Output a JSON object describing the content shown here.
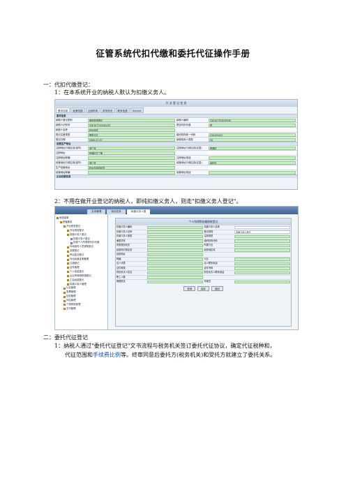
{
  "document": {
    "title": "征管系统代扣代缴和委托代征操作手册",
    "sec1_heading": "一：代扣代缴登记：",
    "sec1_item1": "1：在本系统开业的纳税人默认为扣缴义务人。",
    "sec1_item2": "2：不用在做开业登记的纳税人，即纯扣缴义务人，则走\"扣缴义务人登记\"。",
    "sec2_heading": "二：委托代征登记",
    "sec2_item1_line1": "1：纳税人通过\"委托代征登记\"文书流程与税务机关签订委托代征协议，确定代征税种和，",
    "sec2_item1_line2_plain": "代征范围和",
    "sec2_item1_line2_blue": "手续费比例",
    "sec2_item1_line2_rest": "等。终审同意后委托方(税务机关)和受托方就建立了委托关系。"
  },
  "screenshot1": {
    "title": "开 业 登 记 信 息",
    "tabs": [
      "基本信息",
      "经营范围",
      "注册机构",
      "财务机关",
      "联系信息",
      "Submit"
    ],
    "section_basic": "基本信息",
    "rows": [
      {
        "l1": "纳税人登记类别",
        "v1": "组织机构登记",
        "l2": "纳税人编码",
        "v2": "330107703030930"
      },
      {
        "l1": "纳税人识别号",
        "v1": "330107712342432",
        "l2": "是否代扣代缴",
        "v2": "是"
      },
      {
        "l1": "纳税人名称",
        "v1": "杭州测试",
        "l2": "",
        "v2": ""
      },
      {
        "l1": "登记注册类型",
        "v1": "国有企业",
        "l2": "组织机构统一代码",
        "v2": "232432432"
      },
      {
        "l1": "登记日期",
        "v1": "2080-07-07",
        "l2": "纳税信用人类型",
        "v2": "20"
      }
    ],
    "section_address": "经营生产地址",
    "address_rows": [
      {
        "l1": "注册地址行政区划(省市)",
        "v1": "浙江省",
        "l2": "注册地址行政区划(区县)",
        "v2": "西湖区"
      },
      {
        "l1": "注册地址",
        "v1": "西湖区文三路",
        "l2": "",
        "v2": ""
      },
      {
        "l1": "注册地址邮编",
        "v1": "",
        "l2": "注册地址电话",
        "v2": ""
      },
      {
        "l1": "经营地址行政区划(省市)",
        "v1": "浙江省",
        "l2": "经营地址行政区划(区县)",
        "v2": "余杭区"
      },
      {
        "l1": "生产经营地址",
        "v1": "杭州市余杭经济",
        "l2": "",
        "v2": ""
      },
      {
        "l1": "经营地址邮编",
        "v1": "",
        "l2": "经营地址电话",
        "v2": ""
      }
    ],
    "section_more": "企业经营信息"
  },
  "screenshot2": {
    "tabs": [
      "文本管理",
      "待办任务",
      "扣缴义务人登"
    ],
    "tree": [
      {
        "label": "系统菜单",
        "indent": 0,
        "kind": "folder"
      },
      {
        "label": "税管服务",
        "indent": 1,
        "kind": "folder"
      },
      {
        "label": "开业税务登记",
        "indent": 2,
        "kind": "folder"
      },
      {
        "label": "开业税务登记",
        "indent": 3,
        "kind": "folder"
      },
      {
        "label": "扣缴义务人登记",
        "indent": 3,
        "kind": "folder"
      },
      {
        "label": "扣缴义务人登记",
        "indent": 4,
        "kind": "doc"
      },
      {
        "label": "扣缴个人所得税代扣代缴",
        "indent": 4,
        "kind": "doc"
      },
      {
        "label": "外地临时人员报验登记",
        "indent": 3,
        "kind": "folder"
      },
      {
        "label": "变更登记",
        "indent": 3,
        "kind": "folder"
      },
      {
        "label": "停业复业登记",
        "indent": 3,
        "kind": "folder"
      },
      {
        "label": "外出经营证明管理",
        "indent": 3,
        "kind": "folder"
      },
      {
        "label": "注销登记",
        "indent": 3,
        "kind": "folder"
      },
      {
        "label": "证件管理",
        "indent": 3,
        "kind": "folder"
      },
      {
        "label": "个人信息登记",
        "indent": 3,
        "kind": "folder"
      },
      {
        "label": "企业所得税税源登记",
        "indent": 3,
        "kind": "folder"
      },
      {
        "label": "工会经费登记",
        "indent": 3,
        "kind": "folder"
      },
      {
        "label": "扣缴义务人管理",
        "indent": 3,
        "kind": "folder"
      },
      {
        "label": "认定管理",
        "indent": 2,
        "kind": "folder"
      },
      {
        "label": "发票管理",
        "indent": 2,
        "kind": "folder"
      },
      {
        "label": "征收管理",
        "indent": 2,
        "kind": "folder"
      },
      {
        "label": "评估管理",
        "indent": 2,
        "kind": "folder"
      },
      {
        "label": "个体税收管理",
        "indent": 2,
        "kind": "folder"
      },
      {
        "label": "文书管理",
        "indent": 2,
        "kind": "folder"
      }
    ],
    "form_title": "个人所得税扣缴税款登记",
    "form_rows": [
      {
        "l1": "扣缴义务人编码",
        "v1": "",
        "l2": "扣缴义务人名称",
        "v2": "",
        "g1": true,
        "g2": false
      },
      {
        "l1": "扣缴义务人名称",
        "v1": "",
        "l2": "登记类别",
        "v2": "扣缴义务人登记",
        "g1": true,
        "g2": false
      },
      {
        "l1": "扣缴义务人类型",
        "v1": "",
        "l2": "注册类型",
        "v2": "",
        "g1": true,
        "g2": true
      },
      {
        "l1": "隶属关系",
        "v1": "",
        "l2": "组织机构代码",
        "v2": "",
        "g1": true,
        "g2": true
      },
      {
        "l1": "所属税务机关",
        "v1": "",
        "l2": "所属行业",
        "v2": "",
        "g1": true,
        "g2": true
      },
      {
        "l1": "经营地行政区划",
        "v1": "",
        "l2": "经营地区域",
        "v2": "",
        "g1": true,
        "g2": true
      },
      {
        "l1": "经营地址",
        "v1": "",
        "l2": "",
        "v2": "",
        "g1": true,
        "g2": false
      },
      {
        "l1": "邮编",
        "v1": "",
        "l2": "行业",
        "v2": "",
        "g1": true,
        "g2": true
      },
      {
        "l1": "法人代表",
        "v1": "",
        "l2": "法人联系电话",
        "v2": "",
        "g1": true,
        "g2": true
      },
      {
        "l1": "证件种类",
        "v1": "",
        "l2": "证件号码",
        "v2": "",
        "g1": true,
        "g2": true
      },
      {
        "l1": "财务负责人姓名",
        "v1": "",
        "l2": "财务负责人联系电话",
        "v2": "",
        "g1": true,
        "g2": true
      },
      {
        "l1": "职工人数",
        "v1": "",
        "l2": "",
        "v2": "",
        "g1": true,
        "g2": false
      },
      {
        "l1": "管理机关",
        "v1": "",
        "l2": "专管员",
        "v2": "",
        "g1": true,
        "g2": true
      }
    ],
    "buttons": [
      "查询",
      "保存",
      "返回"
    ]
  }
}
